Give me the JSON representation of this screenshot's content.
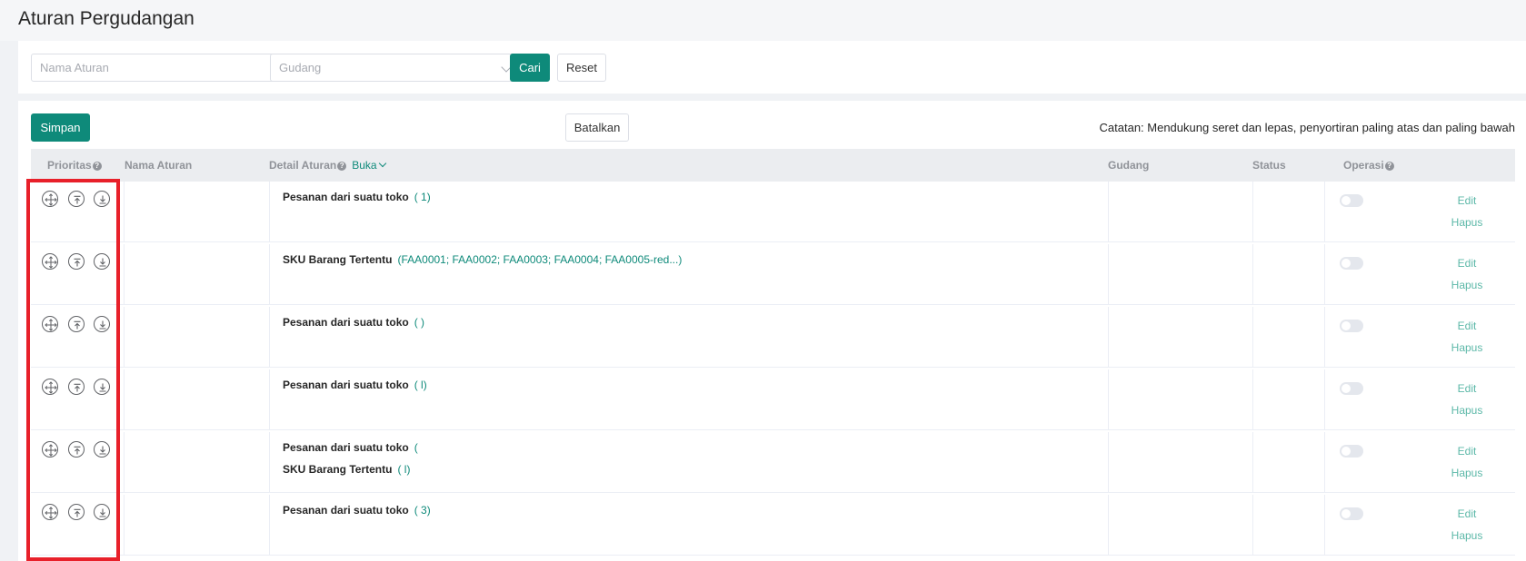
{
  "page": {
    "title": "Aturan Pergudangan"
  },
  "filters": {
    "name_placeholder": "Nama Aturan",
    "gudang_placeholder": "Gudang",
    "search_label": "Cari",
    "reset_label": "Reset"
  },
  "toolbar": {
    "save_label": "Simpan",
    "cancel_label": "Batalkan",
    "note": "Catatan: Mendukung seret dan lepas, penyortiran paling atas dan paling bawah"
  },
  "table": {
    "headers": {
      "priority": "Prioritas",
      "name": "Nama Aturan",
      "detail": "Detail Aturan",
      "expand": "Buka",
      "warehouse": "Gudang",
      "status": "Status",
      "operation": "Operasi"
    },
    "rows": [
      {
        "lines": [
          {
            "label": "Pesanan dari suatu toko",
            "value": "(                    1)"
          }
        ],
        "edit": "Edit",
        "delete": "Hapus"
      },
      {
        "lines": [
          {
            "label": "SKU Barang Tertentu",
            "value": "(FAA0001;  FAA0002;  FAA0003;  FAA0004;  FAA0005-red...)"
          }
        ],
        "edit": "Edit",
        "delete": "Hapus"
      },
      {
        "lines": [
          {
            "label": "Pesanan dari suatu toko",
            "value": "(                                                  )"
          }
        ],
        "edit": "Edit",
        "delete": "Hapus"
      },
      {
        "lines": [
          {
            "label": "Pesanan dari suatu toko",
            "value": "(          l)"
          }
        ],
        "edit": "Edit",
        "delete": "Hapus"
      },
      {
        "lines": [
          {
            "label": "Pesanan dari suatu toko",
            "value": "("
          },
          {
            "label": "SKU Barang Tertentu",
            "value": "(                  l)"
          }
        ],
        "edit": "Edit",
        "delete": "Hapus"
      },
      {
        "lines": [
          {
            "label": "Pesanan dari suatu toko",
            "value": "(    3)"
          }
        ],
        "edit": "Edit",
        "delete": "Hapus"
      }
    ]
  },
  "icons": {
    "drag": "drag-move-icon",
    "top": "move-to-top-icon",
    "bottom": "move-to-bottom-icon"
  },
  "colors": {
    "primary": "#0e8a7a",
    "link": "#5cb8a8",
    "highlight": "#e8202a"
  }
}
